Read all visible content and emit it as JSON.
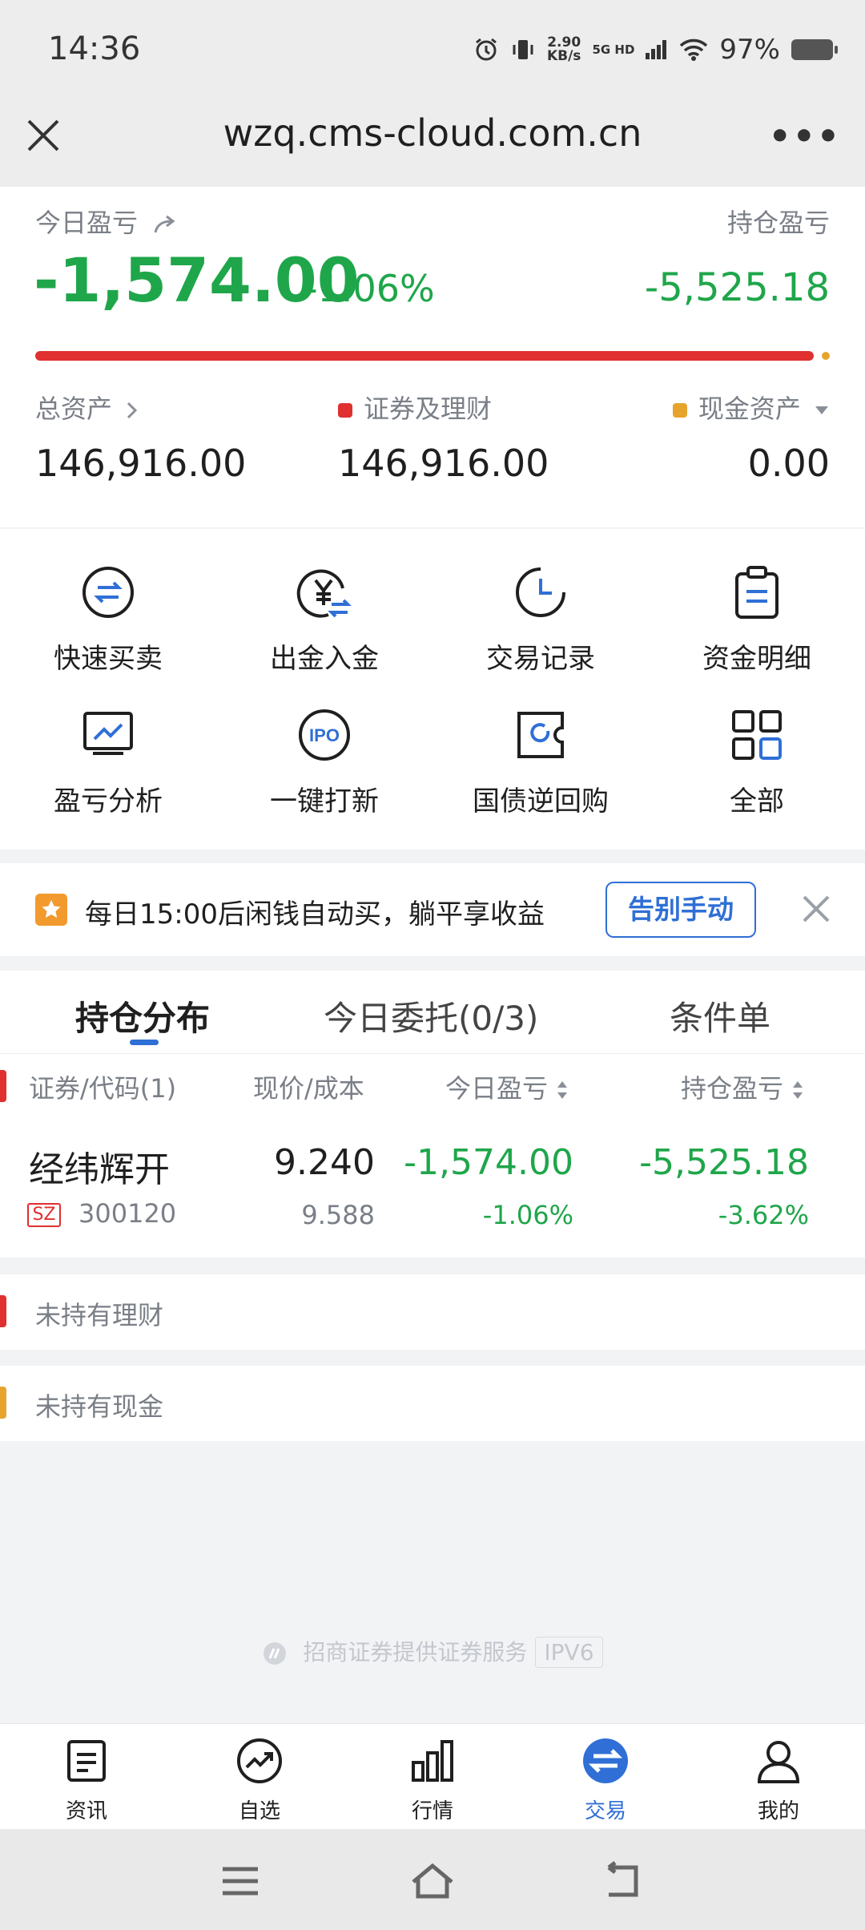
{
  "status": {
    "time": "14:36",
    "speed": "2.90",
    "speed_unit": "KB/s",
    "network": "5G HD",
    "battery": "97%"
  },
  "browser": {
    "url": "wzq.cms-cloud.com.cn",
    "more": "•••"
  },
  "summary": {
    "today_label": "今日盈亏",
    "hold_label": "持仓盈亏",
    "today_value": "-1,574.00",
    "today_pct": "-1.06%",
    "hold_value": "-5,525.18",
    "total_assets_label": "总资产",
    "total_assets": "146,916.00",
    "securities_label": "证券及理财",
    "securities": "146,916.00",
    "cash_label": "现金资产",
    "cash": "0.00",
    "colors": {
      "securities": "#e03030",
      "cash": "#e7a42d"
    }
  },
  "menu": [
    {
      "label": "快速买卖",
      "icon": "swap-icon"
    },
    {
      "label": "出金入金",
      "icon": "yuan-transfer-icon"
    },
    {
      "label": "交易记录",
      "icon": "clock-icon"
    },
    {
      "label": "资金明细",
      "icon": "clipboard-icon"
    },
    {
      "label": "盈亏分析",
      "icon": "chart-monitor-icon"
    },
    {
      "label": "一键打新",
      "icon": "ipo-icon"
    },
    {
      "label": "国债逆回购",
      "icon": "repo-ticket-icon"
    },
    {
      "label": "全部",
      "icon": "grid-icon"
    }
  ],
  "banner": {
    "text": "每日15:00后闲钱自动买，躺平享收益",
    "button": "告别手动"
  },
  "tabs": [
    "持仓分布",
    "今日委托(0/3)",
    "条件单"
  ],
  "table": {
    "headers": [
      "证券/代码(1)",
      "现价/成本",
      "今日盈亏",
      "持仓盈亏"
    ],
    "rows": [
      {
        "name": "经纬辉开",
        "market": "SZ",
        "code": "300120",
        "price": "9.240",
        "cost": "9.588",
        "today": "-1,574.00",
        "today_pct": "-1.06%",
        "hold": "-5,525.18",
        "hold_pct": "-3.62%"
      }
    ]
  },
  "sections": {
    "wealth": "未持有理财",
    "cash": "未持有现金"
  },
  "footer": {
    "text": "招商证券提供证券服务",
    "badge": "IPV6"
  },
  "nav": [
    {
      "label": "资讯",
      "icon": "news-icon"
    },
    {
      "label": "自选",
      "icon": "trend-icon"
    },
    {
      "label": "行情",
      "icon": "bar-chart-icon"
    },
    {
      "label": "交易",
      "icon": "trade-icon",
      "active": true
    },
    {
      "label": "我的",
      "icon": "user-icon"
    }
  ],
  "accent": "#2f6fd6"
}
